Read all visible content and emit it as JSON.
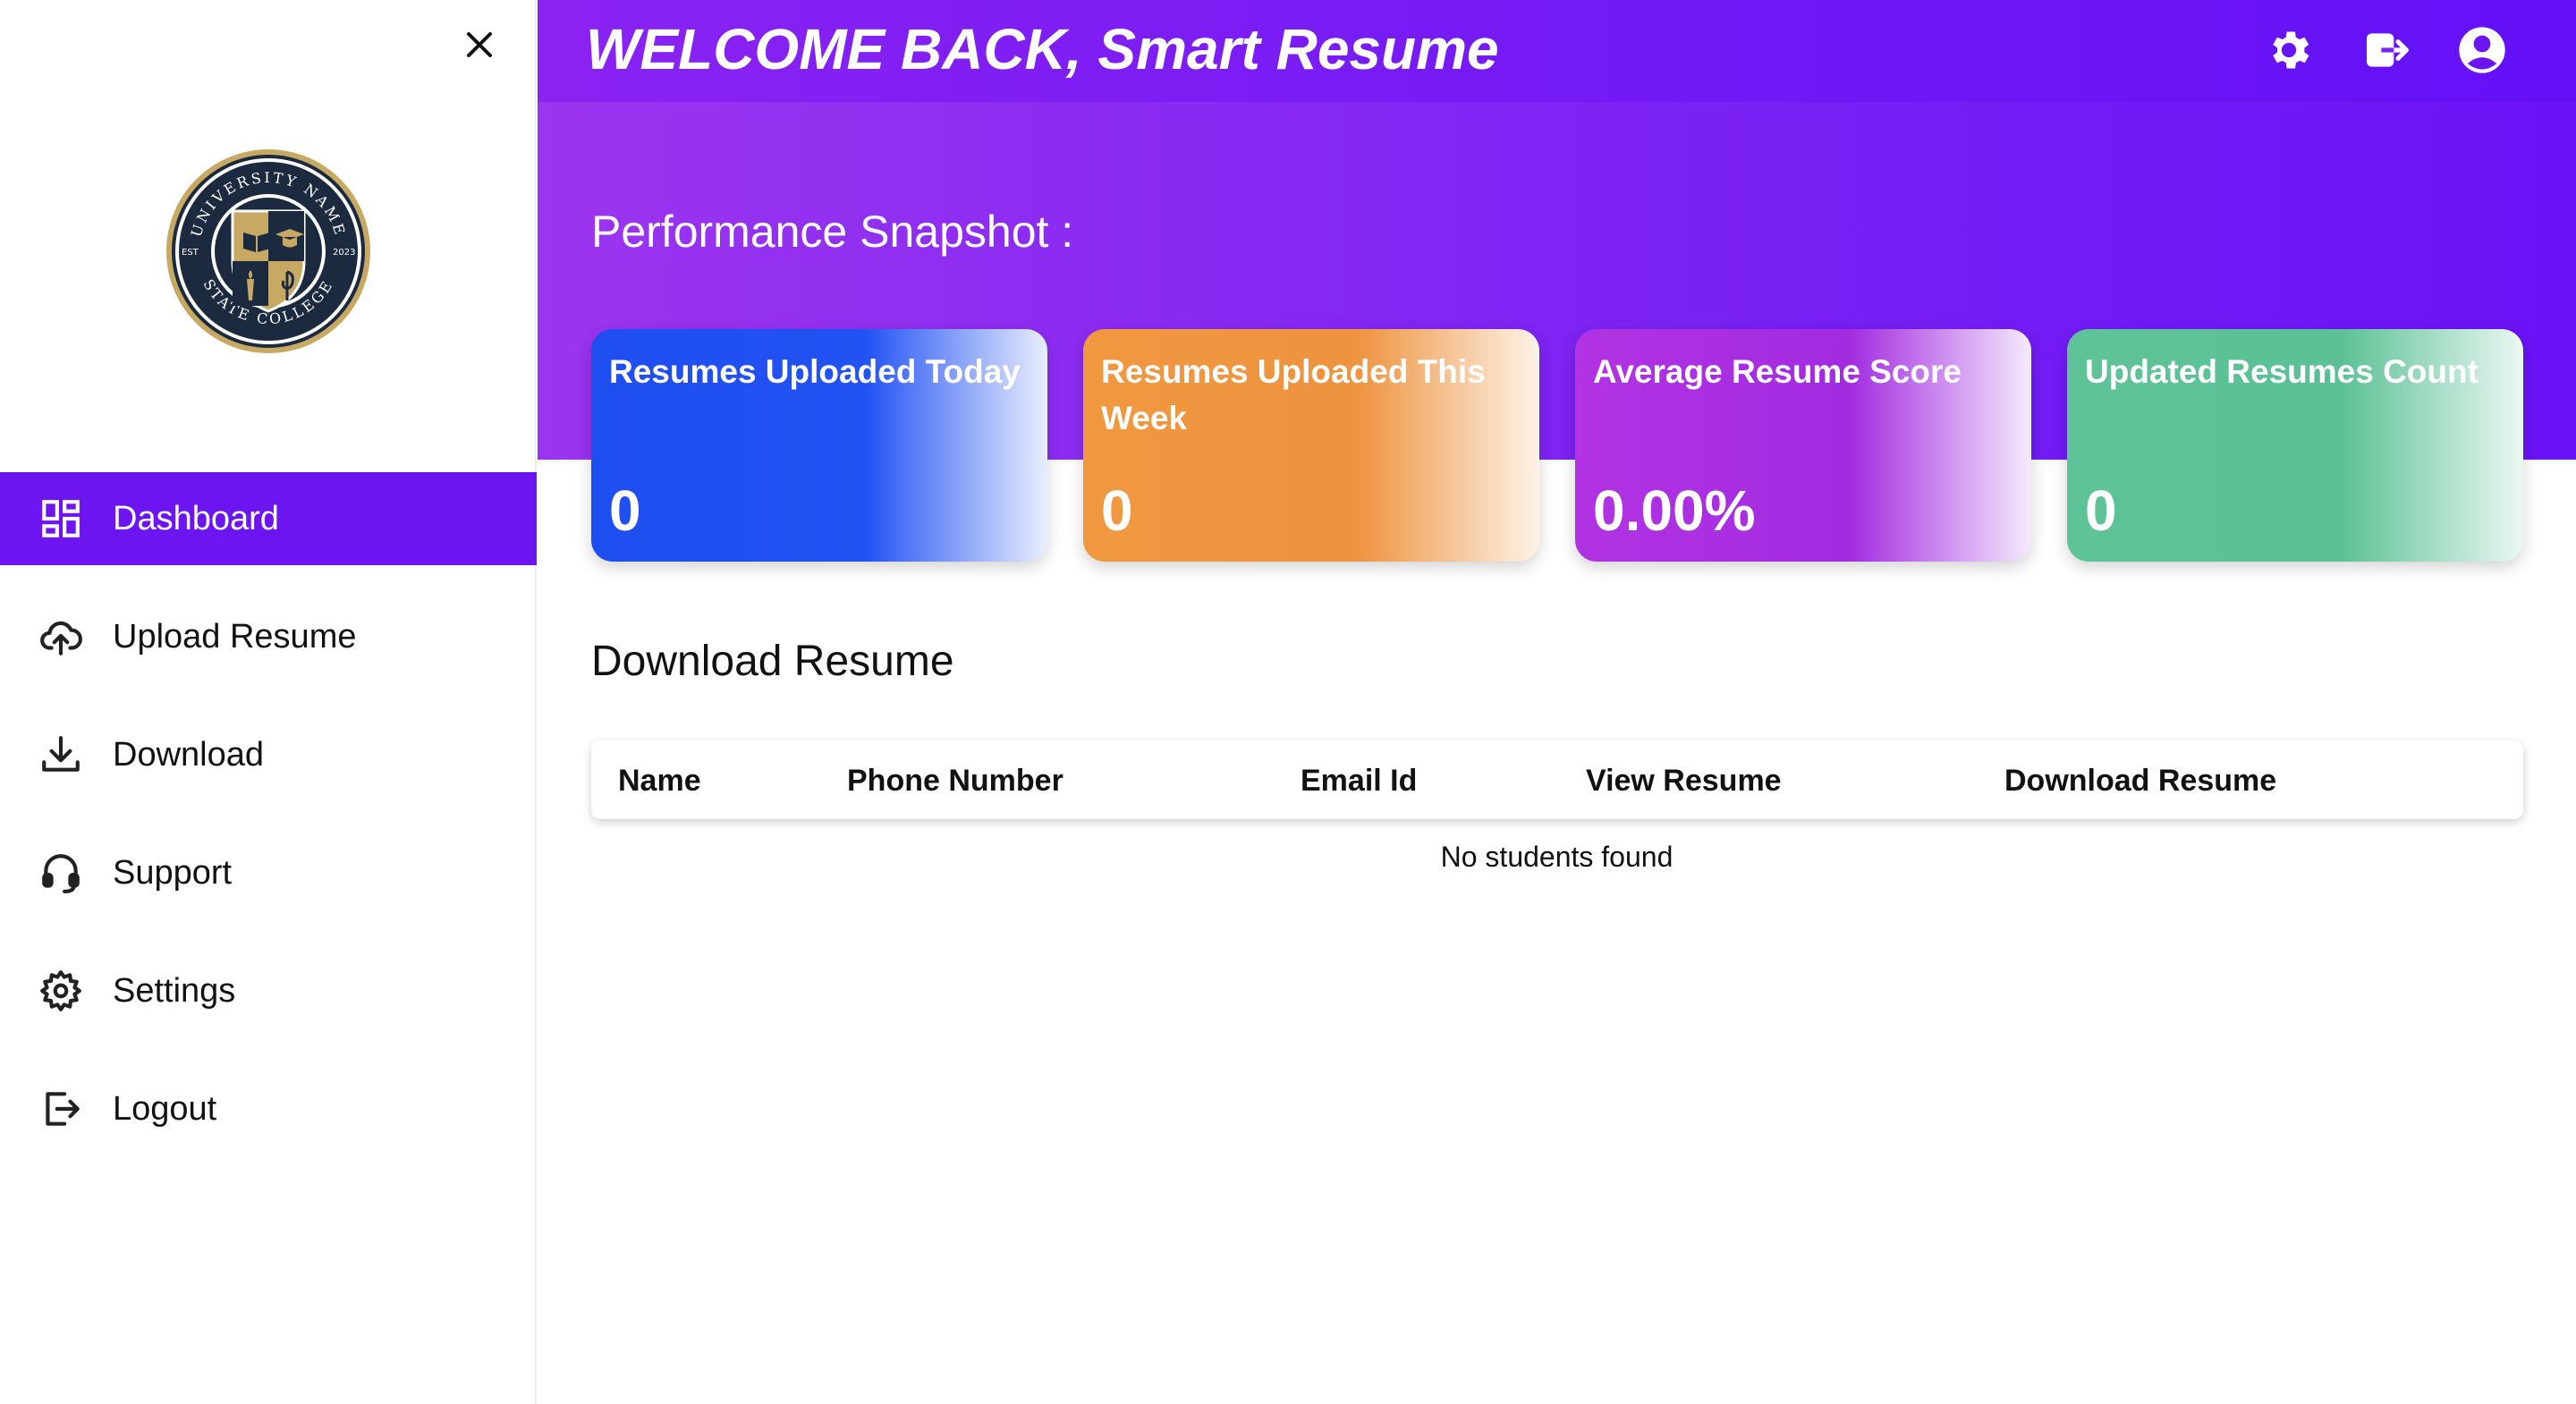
{
  "sidebar": {
    "close_icon": "close-icon",
    "logo": {
      "top_text": "UNIVERSITY NAME",
      "bottom_text": "STATE COLLEGE",
      "est_label": "EST",
      "year": "2023"
    },
    "items": [
      {
        "label": "Dashboard",
        "icon": "dashboard-icon",
        "active": true
      },
      {
        "label": "Upload Resume",
        "icon": "cloud-upload-icon",
        "active": false
      },
      {
        "label": "Download",
        "icon": "download-icon",
        "active": false
      },
      {
        "label": "Support",
        "icon": "headset-icon",
        "active": false
      },
      {
        "label": "Settings",
        "icon": "gear-icon",
        "active": false
      },
      {
        "label": "Logout",
        "icon": "logout-icon",
        "active": false
      }
    ]
  },
  "header": {
    "welcome": "WELCOME BACK, Smart Resume",
    "icons": [
      "gear-icon",
      "logout-icon",
      "account-circle-icon"
    ]
  },
  "snapshot": {
    "title": "Performance Snapshot :",
    "cards": [
      {
        "title": "Resumes Uploaded Today",
        "value": "0",
        "color": "#1f4ef0"
      },
      {
        "title": "Resumes Uploaded This Week",
        "value": "0",
        "color": "#f09840"
      },
      {
        "title": "Average Resume Score",
        "value": "0.00%",
        "color": "#b133e3"
      },
      {
        "title": "Updated Resumes Count",
        "value": "0",
        "color": "#5ec398"
      }
    ]
  },
  "download": {
    "title": "Download Resume",
    "columns": [
      "Name",
      "Phone Number",
      "Email Id",
      "View Resume",
      "Download Resume"
    ],
    "empty_text": "No students found"
  },
  "colors": {
    "accent": "#6d15f0",
    "header_gradient_start": "#9b35ef",
    "header_gradient_end": "#6a12f6"
  }
}
